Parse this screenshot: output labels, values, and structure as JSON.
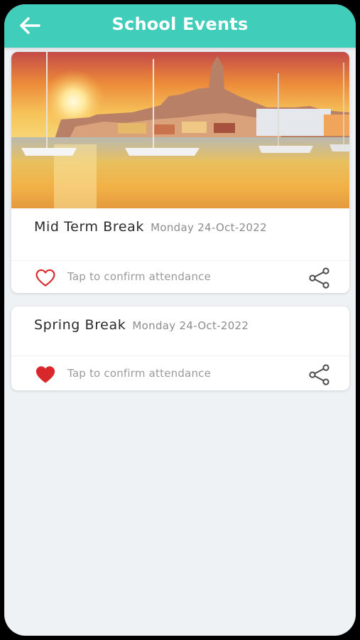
{
  "header": {
    "title": "School Events",
    "back_icon": "arrow-left-icon",
    "background_color": "#40cdb9"
  },
  "events": [
    {
      "title": "Mid Term Break",
      "date": "Monday 24-Oct-2022",
      "attendance_label": "Tap to confirm attendance",
      "attending": false,
      "has_image": true,
      "image_description": "harbor-sunset-photo"
    },
    {
      "title": "Spring Break",
      "date": "Monday 24-Oct-2022",
      "attendance_label": "Tap to confirm attendance",
      "attending": true,
      "has_image": false
    }
  ],
  "icons": {
    "heart_outline": "heart-outline-icon",
    "heart_filled": "heart-filled-icon",
    "share": "share-icon"
  },
  "colors": {
    "heart": "#d9282b",
    "page_background": "#eff2f5"
  }
}
